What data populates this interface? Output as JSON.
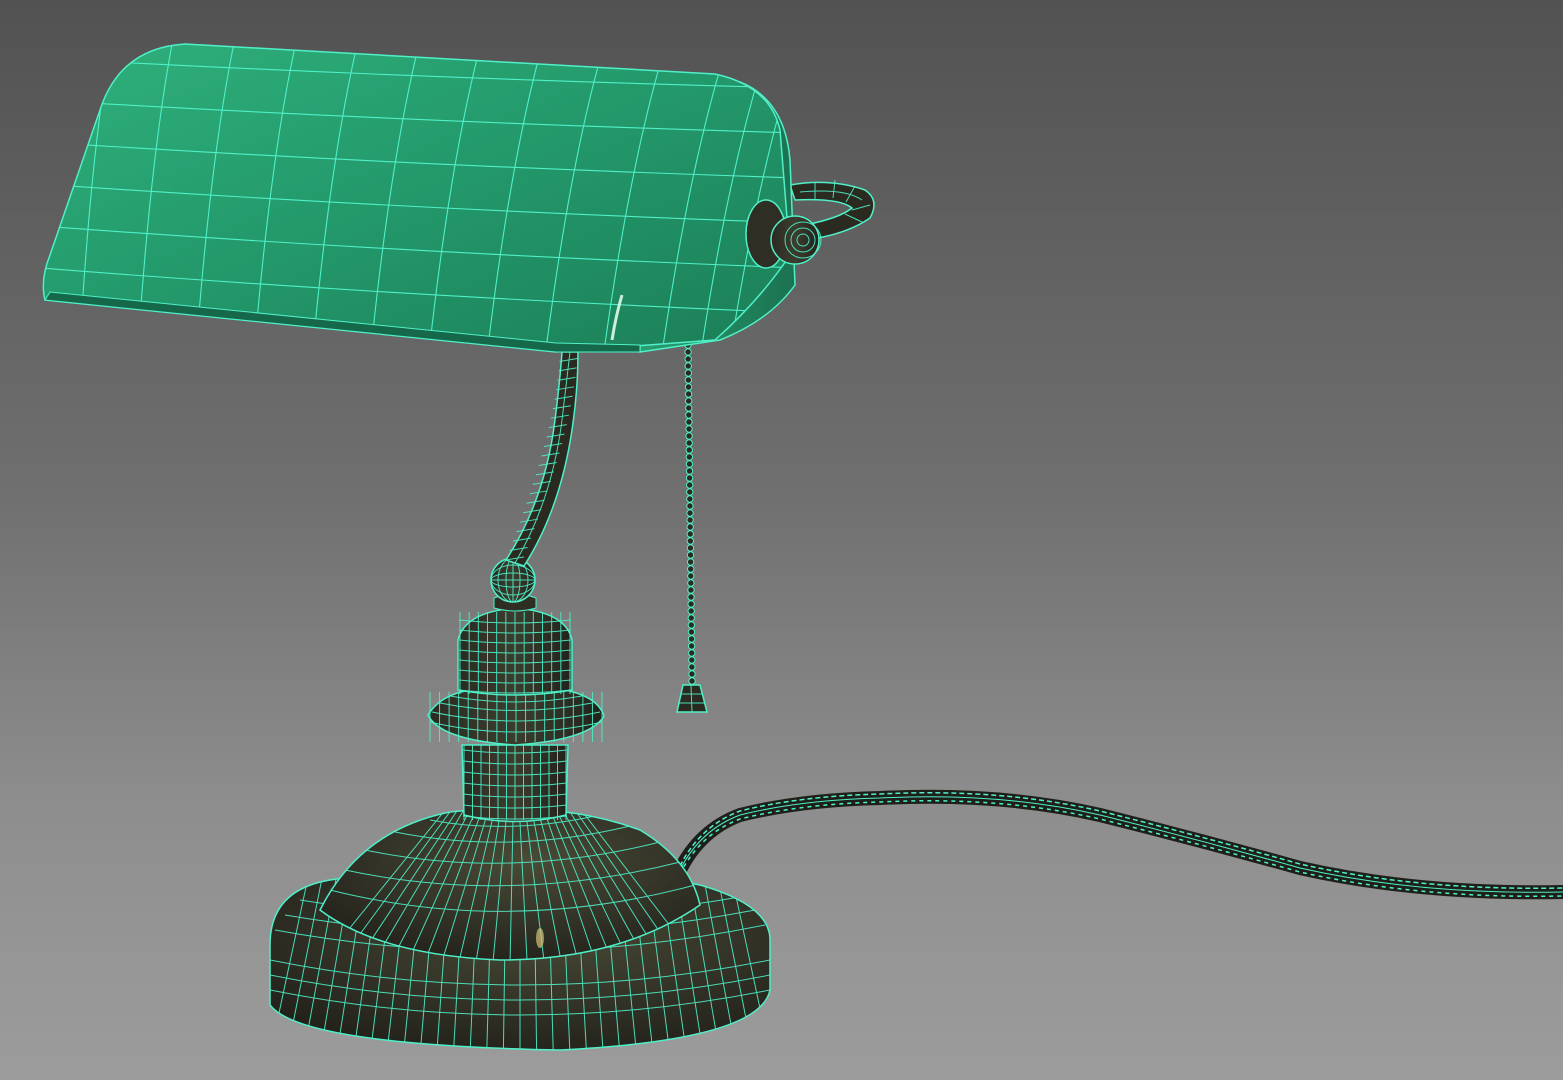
{
  "viewport": {
    "view": "3d-viewport",
    "render_mode": "shaded-with-wireframe",
    "background_gradient": [
      "#525252",
      "#9c9c9c"
    ]
  },
  "model": {
    "object": "bankers-lamp",
    "colors": {
      "shade": "#23986a",
      "shade_highlight": "#3fc48f",
      "metal": "#2a2a20",
      "metal_highlight": "#4a4a36",
      "wire": "#4ff0c8"
    }
  }
}
